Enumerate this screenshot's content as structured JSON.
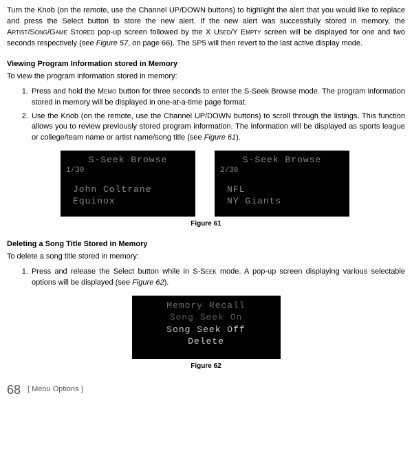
{
  "intro_html": "Turn the Knob (on the remote, use the Channel UP/DOWN buttons) to highlight the alert that you would like to replace and press the Select button to store the new alert. If the new alert was successfully stored in memory, the A<span class=\"smallcaps\">rtist</span>/S<span class=\"smallcaps\">ong</span>/G<span class=\"smallcaps\">ame</span> S<span class=\"smallcaps\">tored</span> pop-up screen followed by the X U<span class=\"smallcaps\">sed</span>/Y E<span class=\"smallcaps\">mpty</span> screen will be displayed for one and two seconds respectively (see <span class=\"italic\">Figure 57</span>, on page 66). The SP5 will then revert to the last active display mode.",
  "section1": {
    "title": "Viewing Program Information stored in Memory",
    "intro": "To view the program information stored in memory:",
    "steps": [
      "Press and hold the M<span class=\"smallcaps\">emo</span> button for three seconds to enter the S-Seek Browse mode. The program information stored in memory will be displayed in one-at-a-time page format.",
      "Use the Knob (on the remote, use the Channel UP/DOWN buttons) to scroll through the listings. This function allows you to review previously stored program information. The information will be displayed as sports league or college/team name or artist name/song title (see <span class=\"italic\">Figure 61</span>)."
    ]
  },
  "screens": {
    "left": {
      "title": "S-Seek Browse",
      "counter": "1/30",
      "line1": "John Coltrane",
      "line2": "Equinox"
    },
    "right": {
      "title": "S-Seek Browse",
      "counter": "2/30",
      "line1": "NFL",
      "line2": "NY Giants"
    }
  },
  "figure61": "Figure 61",
  "section2": {
    "title": "Deleting a Song Title Stored in Memory",
    "intro": "To delete a song title stored in memory:",
    "steps": [
      "Press and release the Select button while in S-S<span class=\"smallcaps\">eek</span> mode.  A pop-up screen displaying various selectable options will be displayed (see <span class=\"italic\">Figure 62</span>)."
    ]
  },
  "menu_screen": {
    "title": "Memory Recall",
    "opt1": "Song Seek On",
    "opt2": "Song Seek Off",
    "opt3": "Delete"
  },
  "figure62": "Figure 62",
  "footer": {
    "page": "68",
    "crumb": "[ Menu Options ]"
  }
}
